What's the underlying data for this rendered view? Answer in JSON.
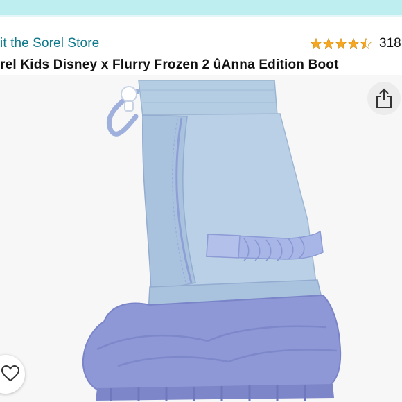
{
  "store": {
    "link_text": "it the Sorel Store"
  },
  "rating": {
    "stars": 4.5,
    "count": "318"
  },
  "product": {
    "title": "rel Kids Disney x Flurry Frozen 2 ûAnna Edition Boot"
  },
  "colors": {
    "header_strip": "#bfeef0",
    "link": "#0f7a8c",
    "star": "#f5a623",
    "boot_upper": "#b7cde2",
    "boot_trim": "#9aa8dc",
    "boot_sole": "#8d95d4"
  },
  "icons": {
    "share": "share-icon",
    "wishlist": "heart-icon"
  }
}
